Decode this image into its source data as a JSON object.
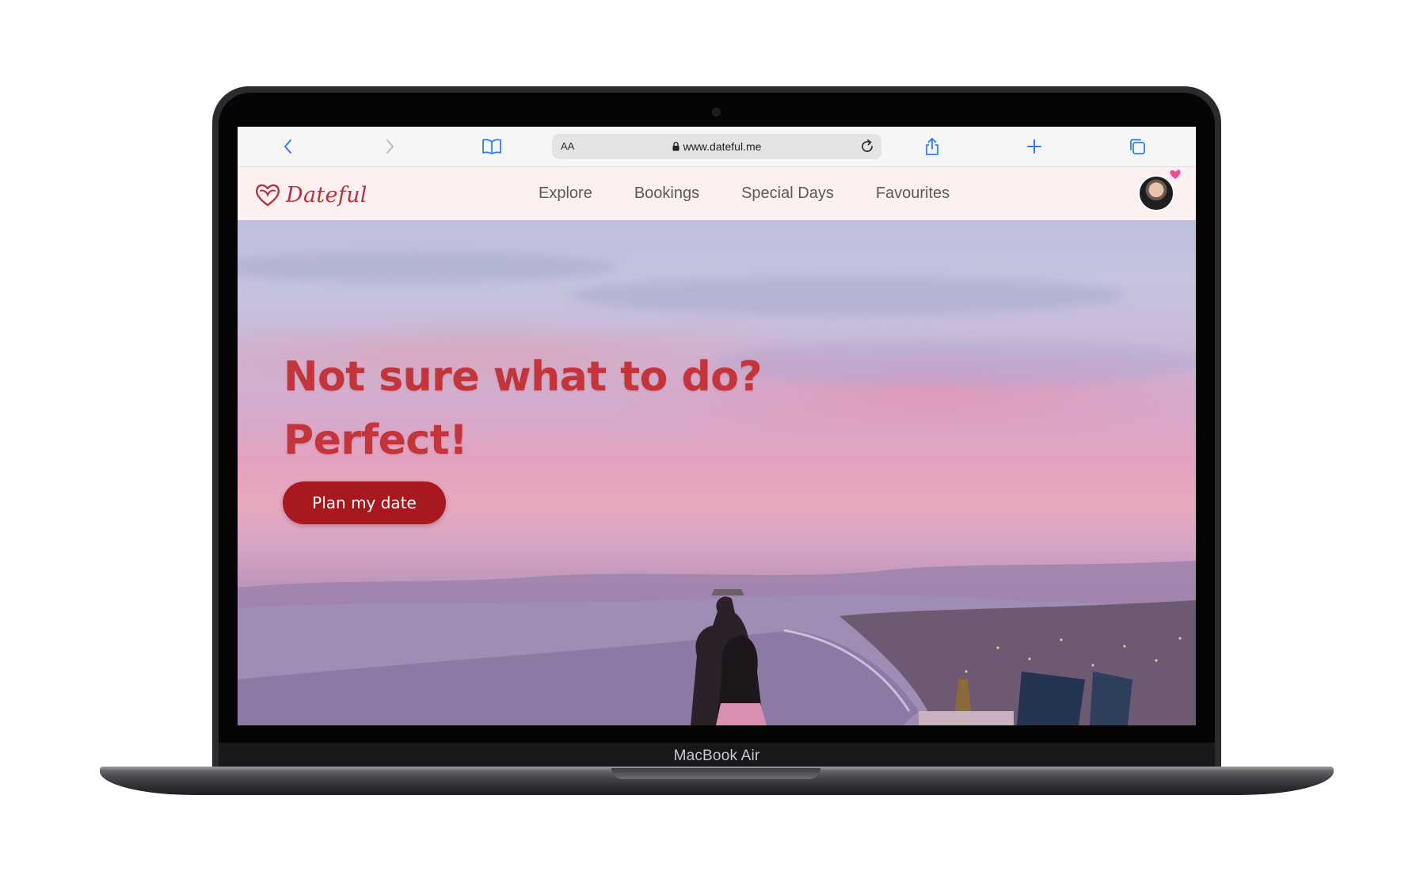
{
  "device": {
    "label": "MacBook Air"
  },
  "browser": {
    "text_size_label": "AA",
    "url": "www.dateful.me",
    "icons": [
      "back-icon",
      "forward-icon",
      "bookmarks-icon",
      "lock-icon",
      "reload-icon",
      "share-icon",
      "new-tab-icon",
      "tabs-icon"
    ],
    "accent_color": "#2f7cf6"
  },
  "site": {
    "logo_text": "Dateful",
    "nav": [
      {
        "label": "Explore"
      },
      {
        "label": "Bookings"
      },
      {
        "label": "Special Days"
      },
      {
        "label": "Favourites"
      }
    ],
    "brand_color": "#b2343d",
    "nav_background": "#fcf0f1"
  },
  "hero": {
    "headline_line1": "Not sure what to do?",
    "headline_line2": "Perfect!",
    "cta_label": "Plan my date",
    "headline_color": "#c3343b",
    "cta_color": "#a7181f"
  }
}
